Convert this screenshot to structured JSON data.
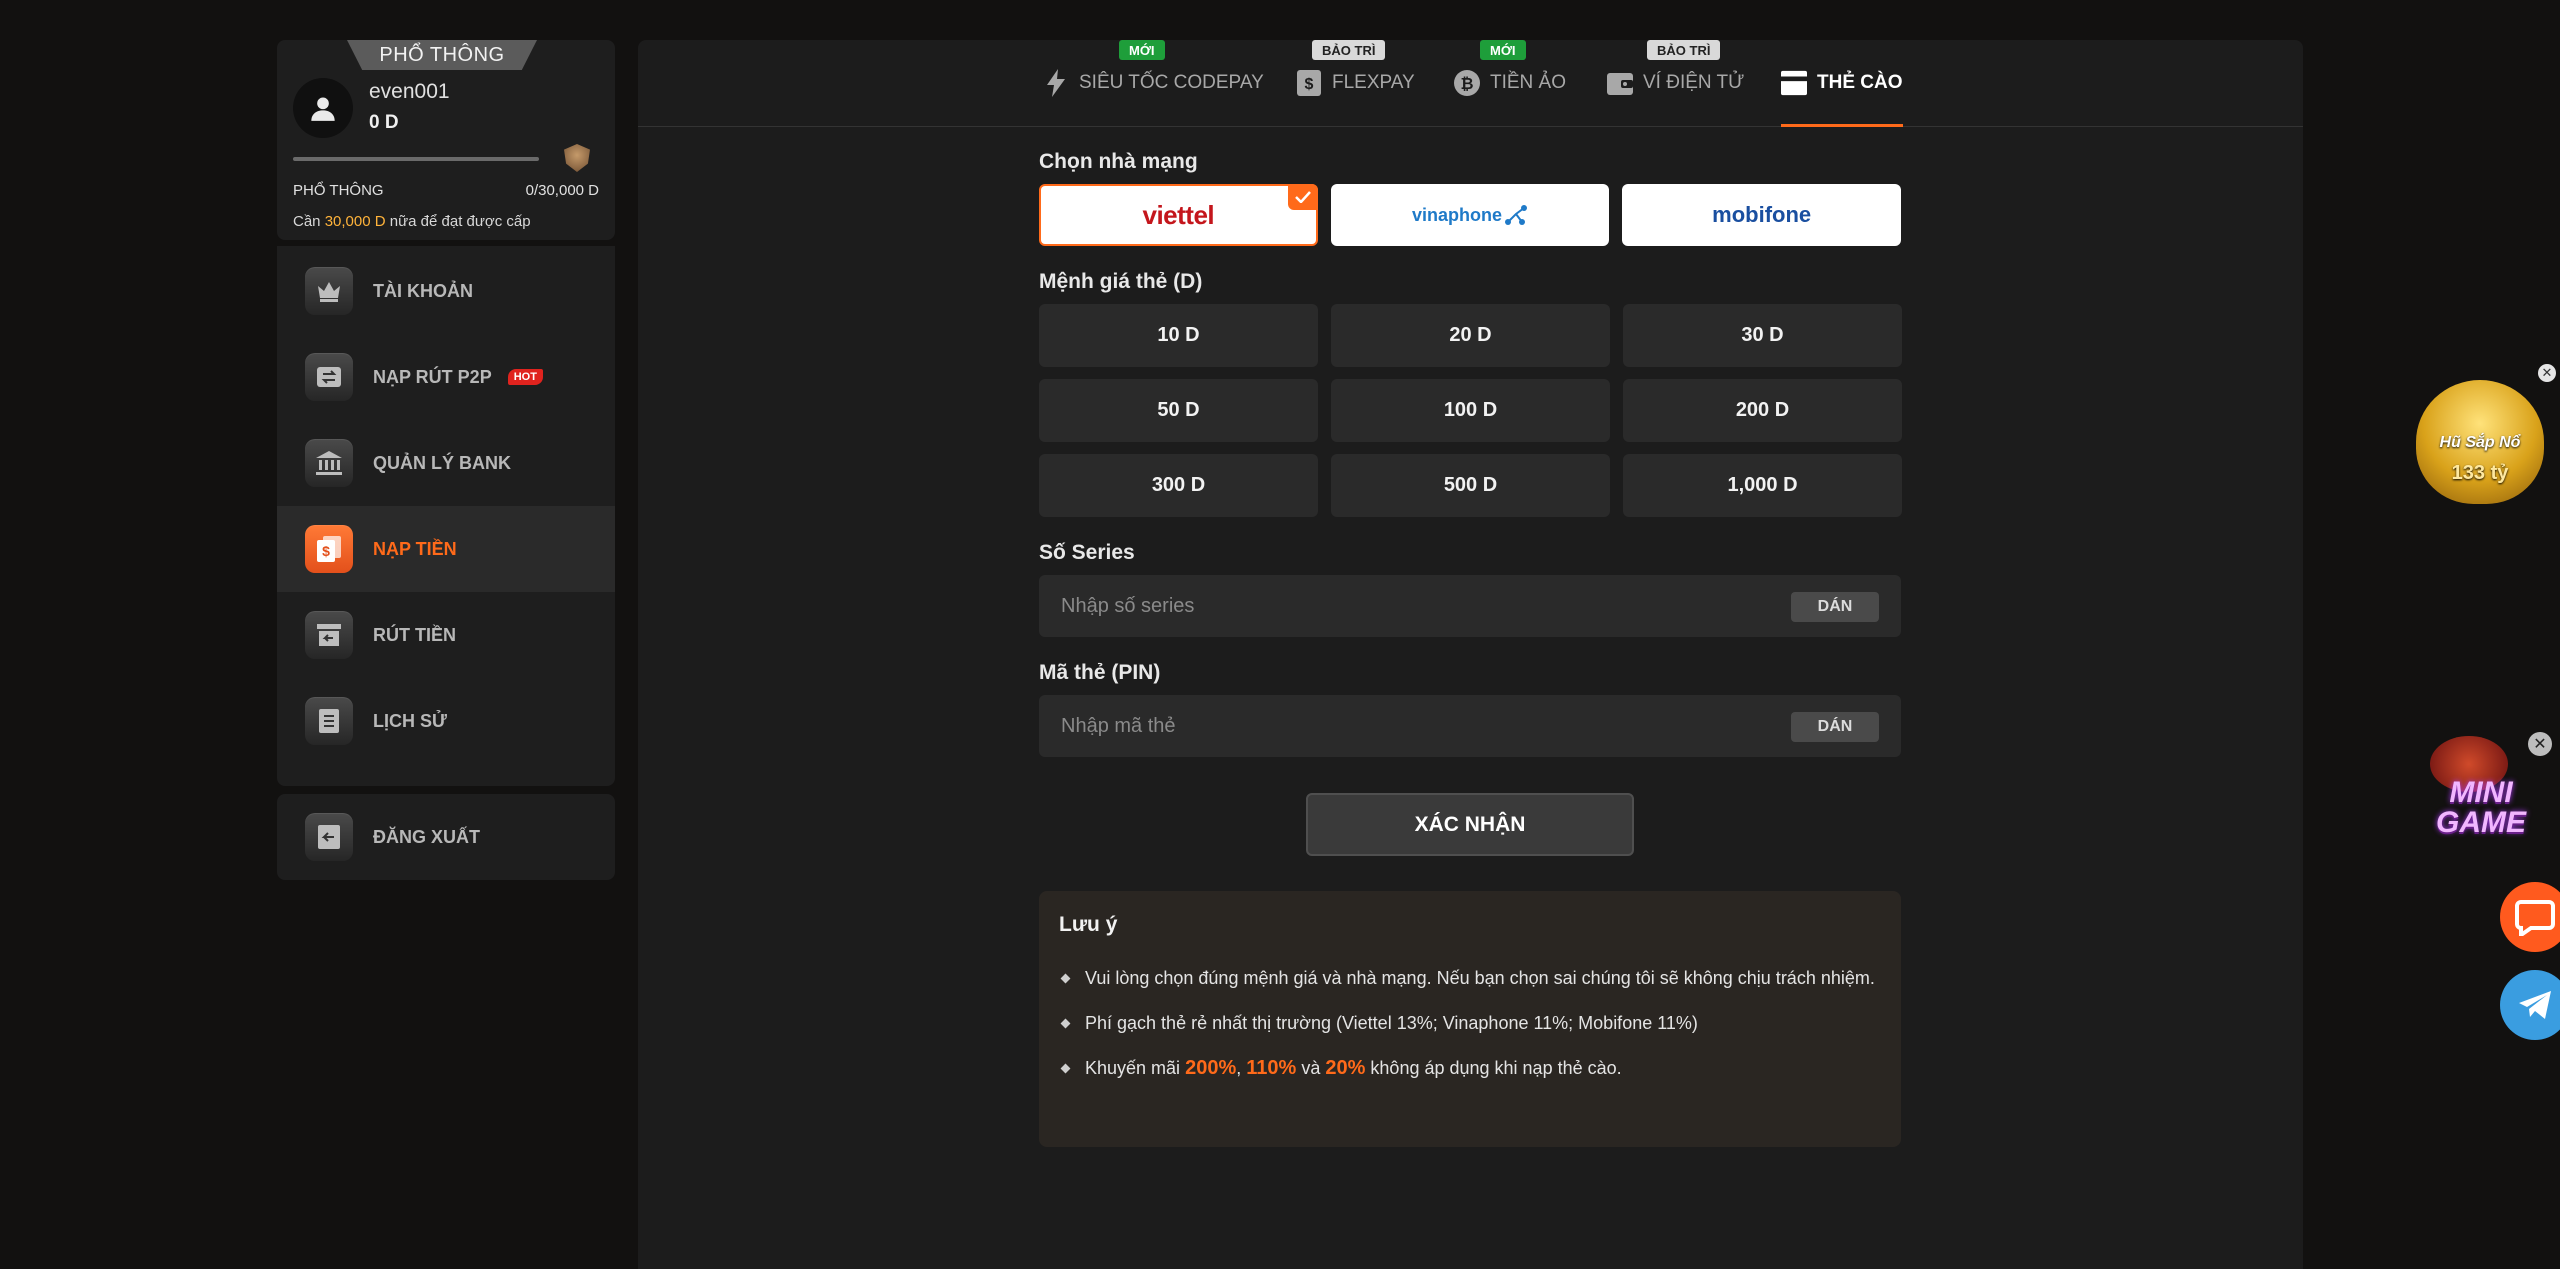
{
  "sidebar": {
    "tier_badge": "PHỔ THÔNG",
    "username": "even001",
    "balance": "0 D",
    "progress": 0,
    "level_name": "PHỔ THÔNG",
    "level_progress": "0/30,000 D",
    "need_prefix": "Cần",
    "need_amount": "30,000 D",
    "need_suffix": "nữa để đạt được cấp",
    "items": [
      {
        "label": "TÀI KHOẢN",
        "icon": "crown-icon"
      },
      {
        "label": "NẠP RÚT P2P",
        "icon": "transfer-icon",
        "badge": "HOT"
      },
      {
        "label": "QUẢN LÝ BANK",
        "icon": "bank-icon"
      },
      {
        "label": "NẠP TIỀN",
        "icon": "deposit-icon",
        "active": true
      },
      {
        "label": "RÚT TIỀN",
        "icon": "withdraw-icon"
      },
      {
        "label": "LỊCH SỬ",
        "icon": "history-icon"
      }
    ],
    "logout_label": "ĐĂNG XUẤT"
  },
  "tabs": [
    {
      "label": "SIÊU TỐC CODEPAY",
      "icon": "lightning-icon",
      "badge": "MỚI",
      "badge_color": "#1e9e3a"
    },
    {
      "label": "FLEXPAY",
      "icon": "dollar-icon",
      "badge": "BẢO TRÌ",
      "badge_color": "#d9d9d9"
    },
    {
      "label": "TIỀN ẢO",
      "icon": "bitcoin-icon",
      "badge": "MỚI",
      "badge_color": "#1e9e3a"
    },
    {
      "label": "VÍ ĐIỆN TỬ",
      "icon": "wallet-icon",
      "badge": "BẢO TRÌ",
      "badge_color": "#d9d9d9"
    },
    {
      "label": "THẺ CÀO",
      "icon": "card-icon",
      "active": true
    }
  ],
  "form": {
    "carrier_label": "Chọn nhà mạng",
    "carriers": [
      {
        "name": "viettel",
        "selected": true
      },
      {
        "name": "vinaphone"
      },
      {
        "name": "mobifone"
      }
    ],
    "amount_label": "Mệnh giá thẻ (D)",
    "amounts": [
      "10 D",
      "20 D",
      "30 D",
      "50 D",
      "100 D",
      "200 D",
      "300 D",
      "500 D",
      "1,000 D"
    ],
    "series_label": "Số Series",
    "series_placeholder": "Nhập số series",
    "pin_label": "Mã thẻ (PIN)",
    "pin_placeholder": "Nhập mã thẻ",
    "paste_label": "DÁN",
    "submit_label": "XÁC NHẬN"
  },
  "note": {
    "title": "Lưu ý",
    "item1": "Vui lòng chọn đúng mệnh giá và nhà mạng. Nếu bạn chọn sai chúng tôi sẽ không chịu trách nhiệm.",
    "item2": "Phí gạch thẻ rẻ nhất thị trường (Viettel 13%; Vinaphone 11%; Mobifone 11%)",
    "item3_prefix": "Khuyến mãi",
    "promo1": "200%",
    "comma": ",",
    "promo2": "110%",
    "and": "và",
    "promo3": "20%",
    "item3_suffix": "không áp dụng khi nạp thẻ cào."
  },
  "widgets": {
    "jackpot_line1": "Hũ Sắp Nổ",
    "jackpot_line2": "133 tỷ",
    "minigame_label": "MINI GAME"
  },
  "colors": {
    "accent": "#ff6a1a",
    "bg": "#121110",
    "panel": "#1c1c1c",
    "highlight_amount": "#ffb33a"
  }
}
